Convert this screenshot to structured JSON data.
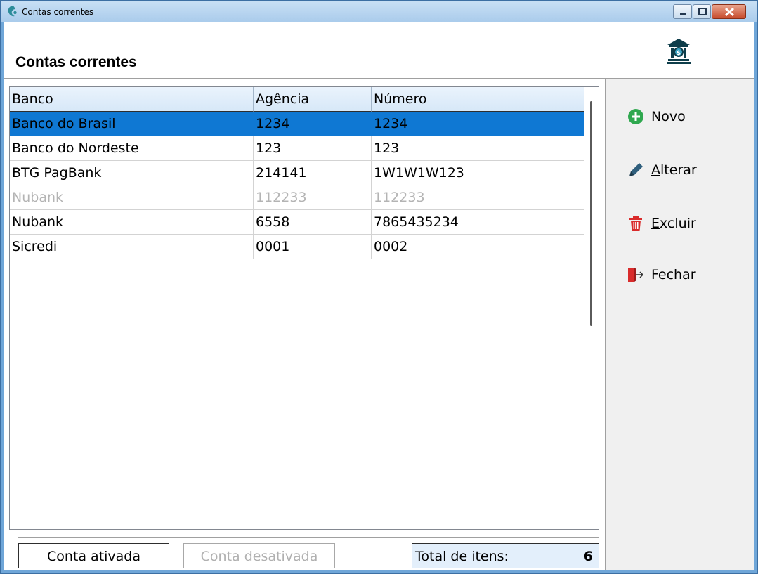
{
  "window": {
    "title": "Contas correntes"
  },
  "header": {
    "page_title": "Contas correntes",
    "icon": "bank-icon"
  },
  "grid": {
    "columns": [
      "Banco",
      "Agência",
      "Número"
    ],
    "rows": [
      {
        "banco": "Banco do Brasil",
        "agencia": "1234",
        "numero": "1234",
        "state": "selected"
      },
      {
        "banco": "Banco do Nordeste",
        "agencia": "123",
        "numero": "123",
        "state": "active"
      },
      {
        "banco": "BTG PagBank",
        "agencia": "214141",
        "numero": "1W1W1W123",
        "state": "active"
      },
      {
        "banco": "Nubank",
        "agencia": "112233",
        "numero": "112233",
        "state": "disabled"
      },
      {
        "banco": "Nubank",
        "agencia": "6558",
        "numero": "7865435234",
        "state": "active"
      },
      {
        "banco": "Sicredi",
        "agencia": "0001",
        "numero": "0002",
        "state": "active"
      }
    ]
  },
  "footer": {
    "active_label": "Conta ativada",
    "inactive_label": "Conta desativada",
    "total_label": "Total de itens:",
    "total_value": "6"
  },
  "actions": {
    "novo": {
      "first": "N",
      "rest": "ovo",
      "icon": "plus-circle-icon",
      "color": "#2fa84f"
    },
    "alterar": {
      "first": "A",
      "rest": "lterar",
      "icon": "pencil-icon"
    },
    "excluir": {
      "first": "E",
      "rest": "xcluir",
      "icon": "trash-icon",
      "color": "#d92b2b"
    },
    "fechar": {
      "first": "F",
      "rest": "echar",
      "icon": "exit-door-icon",
      "color": "#d92b2b"
    }
  },
  "colors": {
    "selection": "#0f78d3",
    "header_bg": "#d7e8f8",
    "disabled_text": "#b4b4b4"
  }
}
